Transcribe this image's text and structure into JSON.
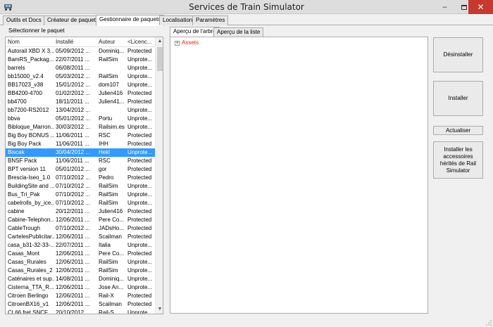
{
  "window": {
    "title": "Services de Train Simulator",
    "minimize": "–",
    "close": "✕"
  },
  "tabs": [
    {
      "label": "Outils et Docs"
    },
    {
      "label": "Créateur de paquets"
    },
    {
      "label": "Gestionnaire de paquets",
      "active": true
    },
    {
      "label": "Localisation"
    },
    {
      "label": "Paramètres"
    }
  ],
  "left": {
    "label": "Sélectionner le paquet",
    "columns": [
      "Nom",
      "Installé",
      "Auteur",
      "<Licenc..."
    ],
    "rows": [
      [
        "Autorail XBD X 3...",
        "05/09/2012 ...",
        "Dominiq...",
        "Protected"
      ],
      [
        "BamRS_Packag...",
        "22/07/2011 ...",
        "RailSim",
        "Unprote..."
      ],
      [
        "barrels",
        "06/08/2011 ...",
        "",
        "Unprote..."
      ],
      [
        "bb15000_v2.4",
        "05/03/2012 ...",
        "RailSim",
        "Unprote..."
      ],
      [
        "BB17023_v38",
        "15/01/2012 ...",
        "dom107",
        "Unprote..."
      ],
      [
        "BB4200-4700",
        "01/02/2012 ...",
        "Julien416",
        "Protected"
      ],
      [
        "bb4700",
        "18/11/2011 ...",
        "Julien41...",
        "Protected"
      ],
      [
        "bb7200-RS2012",
        "13/04/2012 ...",
        "",
        "Unprote..."
      ],
      [
        "bbva",
        "05/01/2012 ...",
        "Portu",
        "Unprote..."
      ],
      [
        "Bibloque_Marron...",
        "30/03/2012 ...",
        "Railsim.es",
        "Unprote..."
      ],
      [
        "Big Boy BONUS ...",
        "11/06/2011 ...",
        "RSC",
        "Protected"
      ],
      [
        "Big Boy Pack",
        "11/06/2011 ...",
        "IHH",
        "Protected"
      ],
      [
        "Biscak",
        "30/04/2012 ...",
        "Hekl",
        "Unprote..."
      ],
      [
        "BNSF Pack",
        "11/06/2011 ...",
        "RSC",
        "Protected"
      ],
      [
        "BPT version 11",
        "05/01/2012 ...",
        "gor",
        "Protected"
      ],
      [
        "Brescia-Iseo_1.0",
        "07/10/2012 ...",
        "Pedro",
        "Protected"
      ],
      [
        "BuildingSite and ...",
        "07/10/2012 ...",
        "RailSim",
        "Unprote..."
      ],
      [
        "Bus_Tri_Pak",
        "07/10/2012 ...",
        "RailSim",
        "Unprote..."
      ],
      [
        "cabelrolls_by_ice...",
        "07/10/2012 ...",
        "RailSim",
        "Unprote..."
      ],
      [
        "cabine",
        "20/12/2011 ...",
        "Julien416",
        "Protected"
      ],
      [
        "Cabine-Telephon...",
        "12/06/2011 ...",
        "Pere Co...",
        "Protected"
      ],
      [
        "CableTrough",
        "07/10/2012 ...",
        "JADsHo...",
        "Protected"
      ],
      [
        "CartelesPublicitar...",
        "12/06/2011 ...",
        "Scailman",
        "Protected"
      ],
      [
        "casa_b31-32-33-...",
        "22/07/2011 ...",
        "Italia",
        "Unprote..."
      ],
      [
        "Casas_Mont",
        "12/06/2011 ...",
        "Pere Co...",
        "Protected"
      ],
      [
        "Casas_Rurales",
        "12/06/2011 ...",
        "RailSim",
        "Unprote..."
      ],
      [
        "Casas_Rurales_2",
        "12/06/2011 ...",
        "RailSim",
        "Unprote..."
      ],
      [
        "Caténaires et sup...",
        "14/08/2011 ...",
        "Dominiq...",
        "Unprote..."
      ],
      [
        "Cisterna_TTA_R...",
        "12/06/2011 ...",
        "Jose An...",
        "Unprote..."
      ],
      [
        "Citroen Berlingo",
        "12/06/2011 ...",
        "Rail-X",
        "Protected"
      ],
      [
        "CitroenBX16_v1",
        "12/06/2011 ...",
        "Scailman",
        "Protected"
      ],
      [
        "CL66 fret SNCF ...",
        "20/10/2012 ...",
        "Rail-S...",
        "Unprote..."
      ]
    ],
    "selected_row": 12
  },
  "right": {
    "tabs": [
      {
        "label": "Aperçu de l'arbre",
        "active": true
      },
      {
        "label": "Aperçu de la liste"
      }
    ],
    "tree_root": "Assets",
    "tree_expander": "+",
    "buttons": {
      "uninstall": "Désinstaller",
      "install": "Installer",
      "refresh": "Actualiser",
      "legacy": "Installer les accessoires hérités de Rail Simulator"
    }
  },
  "colors": {
    "selection": "#3399FF",
    "tree_root": "#E0271E",
    "close": "#C7392E"
  }
}
